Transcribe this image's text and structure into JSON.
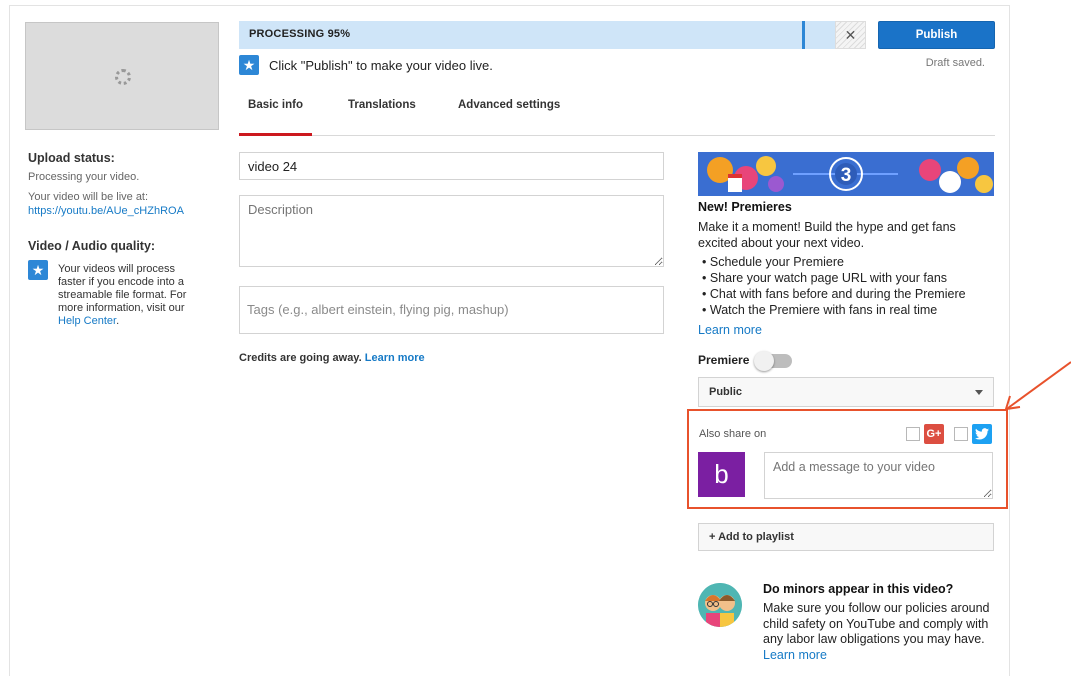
{
  "thumbnail": {
    "status_icon": "loading-spinner-icon"
  },
  "upload_status": {
    "title": "Upload status:",
    "state": "Processing your video.",
    "live_prefix": "Your video will be live at:",
    "url": "https://youtu.be/AUe_cHZhROA"
  },
  "quality": {
    "title": "Video / Audio quality:",
    "icon": "star-icon",
    "text": "Your videos will process faster if you encode into a streamable file format. For more information, visit our",
    "link": "Help Center",
    "suffix": "."
  },
  "processing": {
    "label": "PROCESSING 95%",
    "progress": 0.95,
    "cancel_glyph": "✕"
  },
  "publish": {
    "label": "Publish",
    "draft_status": "Draft saved."
  },
  "hint": {
    "icon": "star-icon",
    "text": "Click \"Publish\" to make your video live."
  },
  "tabs": [
    {
      "label": "Basic info",
      "active": true
    },
    {
      "label": "Translations",
      "active": false
    },
    {
      "label": "Advanced settings",
      "active": false
    }
  ],
  "form": {
    "title_value": "video 24",
    "description_placeholder": "Description",
    "tags_placeholder": "Tags (e.g., albert einstein, flying pig, mashup)",
    "credits_text": "Credits are going away.",
    "credits_link": "Learn more"
  },
  "premieres": {
    "banner_number": "3",
    "title": "New! Premieres",
    "description": "Make it a moment! Build the hype and get fans excited about your next video.",
    "bullets": [
      "Schedule your Premiere",
      "Share your watch page URL with your fans",
      "Chat with fans before and during the Premiere",
      "Watch the Premiere with fans in real time"
    ],
    "learn_more": "Learn more",
    "toggle_label": "Premiere",
    "toggle_on": false
  },
  "privacy": {
    "selected": "Public"
  },
  "share": {
    "label": "Also share on",
    "gplus_glyph": "G+",
    "twitter_glyph": "🐦",
    "avatar_letter": "b",
    "message_placeholder": "Add a message to your video",
    "annotation_color": "#e8522c"
  },
  "playlist": {
    "label": "+ Add to playlist"
  },
  "minors": {
    "title": "Do minors appear in this video?",
    "text": "Make sure you follow our policies around child safety on YouTube and comply with any labor law obligations you may have.",
    "link": "Learn more"
  },
  "colors": {
    "accent": "#1a73c8",
    "tab_active": "#cc181e",
    "progress_bg": "#cfe5f8"
  }
}
